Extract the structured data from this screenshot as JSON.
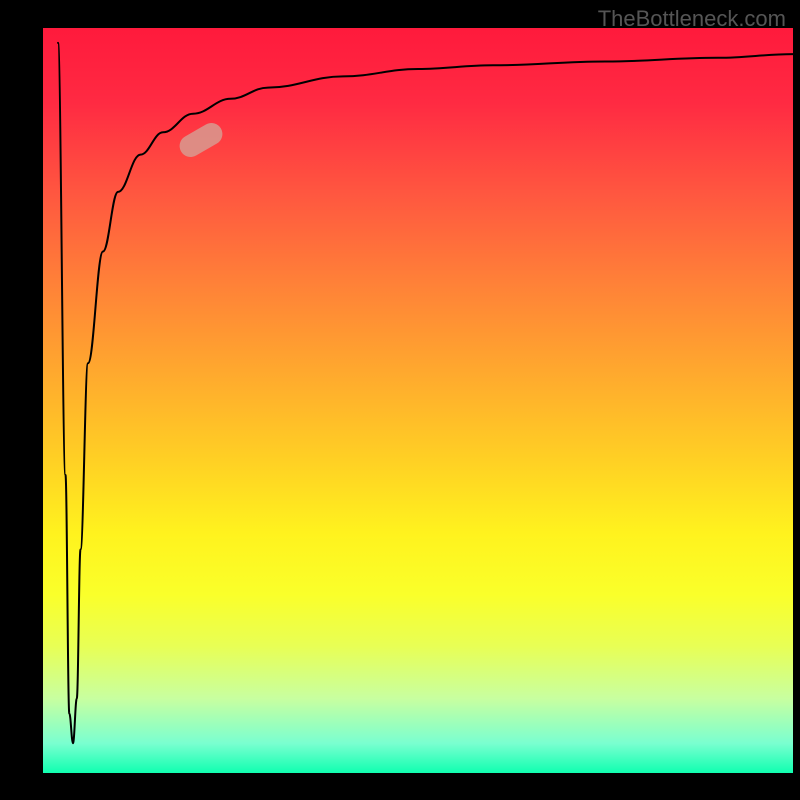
{
  "watermark": "TheBottleneck.com",
  "chart_data": {
    "type": "line",
    "title": "",
    "xlabel": "",
    "ylabel": "",
    "xlim": [
      0,
      100
    ],
    "ylim": [
      0,
      100
    ],
    "grid": false,
    "series": [
      {
        "name": "curve",
        "x": [
          2,
          3,
          3.5,
          4,
          4.5,
          5,
          6,
          8,
          10,
          13,
          16,
          20,
          25,
          30,
          40,
          50,
          60,
          75,
          90,
          100
        ],
        "y": [
          98,
          40,
          8,
          4,
          10,
          30,
          55,
          70,
          78,
          83,
          86,
          88.5,
          90.5,
          92,
          93.5,
          94.5,
          95,
          95.5,
          96,
          96.5
        ]
      }
    ],
    "marker": {
      "x": 21,
      "y": 85,
      "angle_deg": -30,
      "color": "#d89a90"
    },
    "background_gradient": {
      "top": "#ff1a3c",
      "mid": "#ffd024",
      "bottom": "#10ffb0"
    }
  }
}
